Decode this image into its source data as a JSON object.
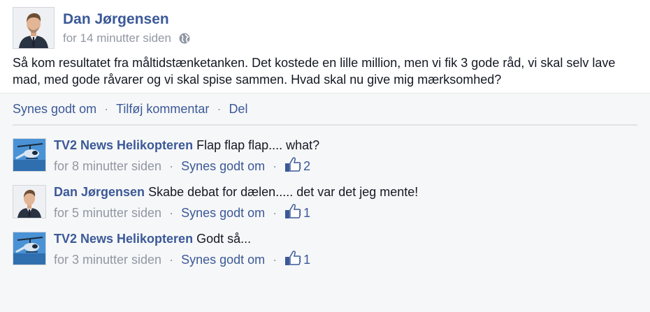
{
  "post": {
    "author": "Dan Jørgensen",
    "time": "for 14 minutter siden",
    "privacy_icon": "globe-icon",
    "text": "Så kom resultatet fra måltidstænketanken. Det kostede en lille million, men vi fik 3 gode råd, vi skal selv lave mad, med gode råvarer og vi skal spise sammen. Hvad skal nu give mig mærksomhed?"
  },
  "actions": {
    "like": "Synes godt om",
    "comment": "Tilføj kommentar",
    "share": "Del",
    "separator": "·"
  },
  "comments": [
    {
      "author": "TV2 News Helikopteren",
      "text": "Flap flap flap....  what?",
      "time": "for 8 minutter siden",
      "like_label": "Synes godt om",
      "like_count": "2",
      "avatar": "helicopter-avatar"
    },
    {
      "author": "Dan Jørgensen",
      "text": "Skabe debat for dælen..... det var det jeg mente!",
      "time": "for 5 minutter siden",
      "like_label": "Synes godt om",
      "like_count": "1",
      "avatar": "person-avatar"
    },
    {
      "author": "TV2 News Helikopteren",
      "text": "Godt så...",
      "time": "for 3 minutter siden",
      "like_label": "Synes godt om",
      "like_count": "1",
      "avatar": "helicopter-avatar"
    }
  ],
  "colors": {
    "link": "#3b5998",
    "meta": "#9197a3",
    "text": "#141823",
    "feedback_bg": "#f6f7f8"
  }
}
